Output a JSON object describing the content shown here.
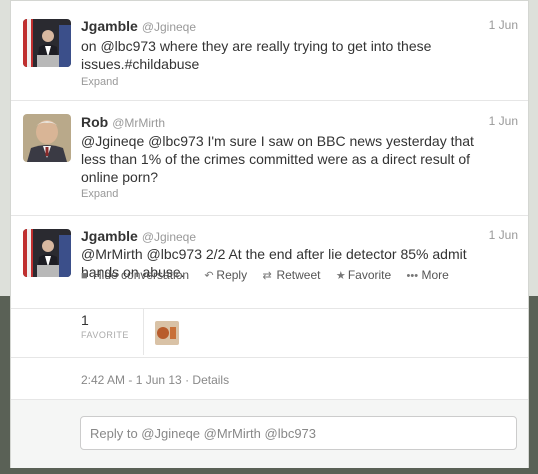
{
  "tweets": [
    {
      "name": "Jgamble",
      "handle": "@Jgineqe",
      "time": "1 Jun",
      "text": "on @lbc973 where they are really trying to get into these issues.#childabuse",
      "expand": "Expand",
      "avatar_icon": "user-avatar"
    },
    {
      "name": "Rob",
      "handle": "@MrMirth",
      "time": "1 Jun",
      "text": "@Jgineqe @lbc973 I'm sure I saw on BBC news yesterday that less than 1% of the crimes committed were as a direct result of online porn?",
      "expand": "Expand",
      "avatar_icon": "user-avatar"
    },
    {
      "name": "Jgamble",
      "handle": "@Jgineqe",
      "time": "1 Jun",
      "text": "@MrMirth @lbc973  2/2 At the end after lie detector 85% admit hands on abuse.",
      "avatar_icon": "user-avatar"
    }
  ],
  "actions": {
    "hide": "Hide conversation",
    "reply": "Reply",
    "retweet": "Retweet",
    "favorite": "Favorite",
    "more": "More"
  },
  "stats": {
    "favorites_count": "1",
    "favorites_label": "FAVORITE"
  },
  "details": {
    "timestamp": "2:42 AM - 1 Jun 13",
    "separator": "·",
    "details_link": "Details"
  },
  "reply": {
    "placeholder": "Reply to @Jgineqe @MrMirth @lbc973"
  },
  "colors": {
    "background_dark": "#5a6156",
    "panel": "#ffffff",
    "muted": "#999999"
  }
}
